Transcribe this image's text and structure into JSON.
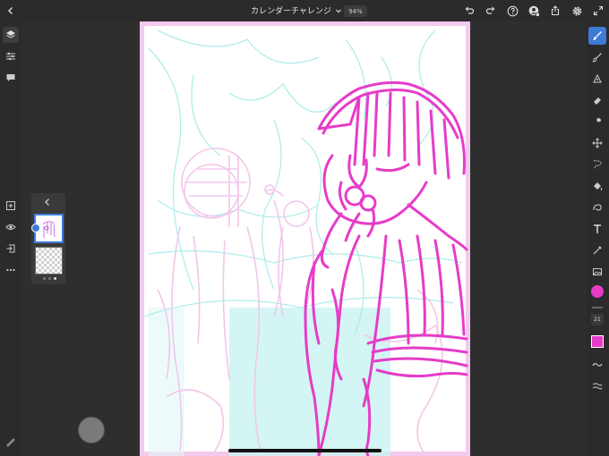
{
  "header": {
    "title": "カレンダーチャレンジ",
    "zoom": "94%"
  },
  "tools": {
    "brush_size": "21"
  },
  "colors": {
    "accent": "#3e7bd6",
    "current_color": "#e63cc8",
    "sketch_magenta": "#e63cc8",
    "sketch_pink": "#f2c7ea",
    "sketch_cyan": "#bff3f0"
  },
  "icons": {
    "topbar": [
      "back-icon",
      "undo-icon",
      "redo-icon",
      "help-icon",
      "profile-icon",
      "share-icon",
      "settings-icon",
      "fullscreen-icon"
    ],
    "left": [
      "layers-icon",
      "adjustments-icon",
      "comments-icon",
      "add-layer-icon",
      "visibility-icon",
      "import-icon",
      "more-icon",
      "brush-settings-icon"
    ],
    "right": [
      "paint-brush-icon",
      "pixel-brush-icon",
      "vector-brush-icon",
      "eraser-icon",
      "smudge-icon",
      "transform-icon",
      "selection-icon",
      "fill-icon",
      "liquify-icon",
      "text-icon",
      "eyedropper-icon",
      "image-icon",
      "stroke-smoothing-icon",
      "pressure-icon"
    ]
  }
}
